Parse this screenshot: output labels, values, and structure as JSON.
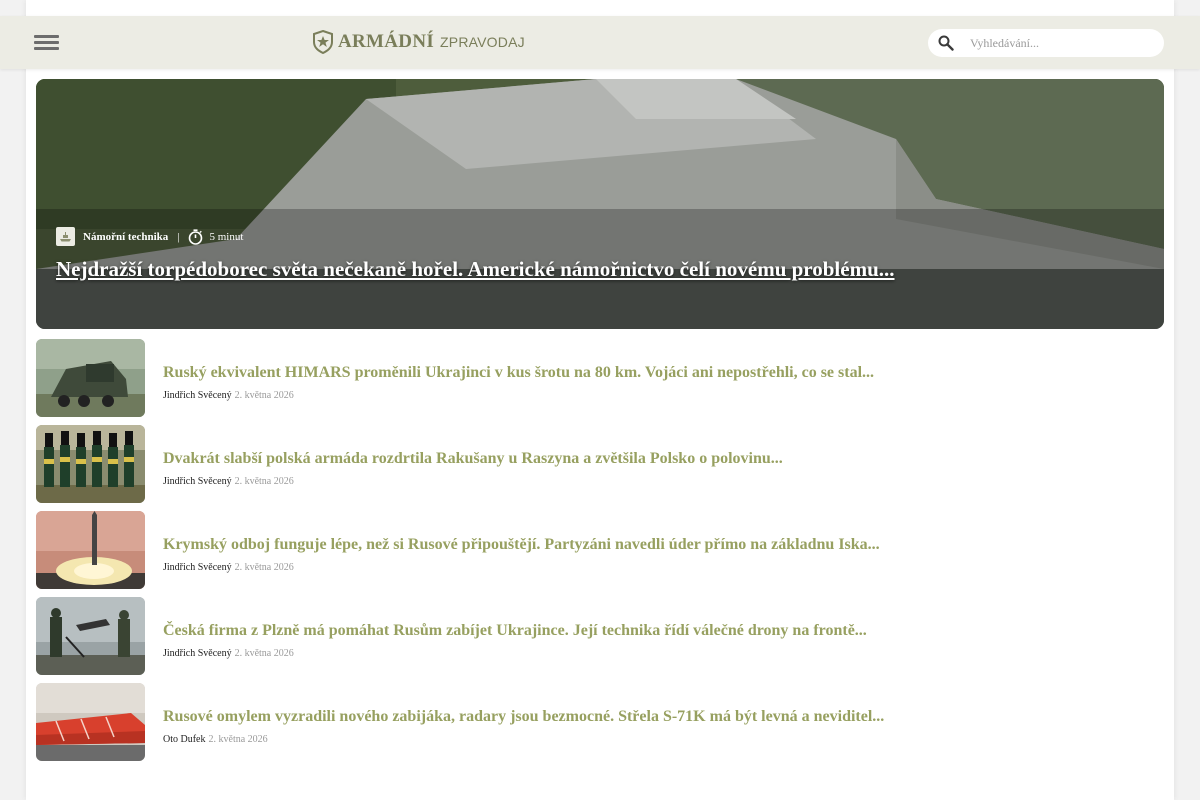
{
  "header": {
    "logo_primary": "ARMÁDNÍ",
    "logo_secondary": "ZPRAVODAJ",
    "search_placeholder": "Vyhledávání..."
  },
  "hero": {
    "category": "Námořní technika",
    "separator": "|",
    "read_time": "5 minut",
    "title": "Nejdražší torpédoborec světa nečekaně hořel. Americké námořnictvo čelí novému problému..."
  },
  "articles": [
    {
      "title": "Ruský ekvivalent HIMARS proměnili Ukrajinci v kus šrotu na 80 km. Vojáci ani nepostřehli, co se stal...",
      "author": "Jindřich Svěcený",
      "date": "2. května 2026"
    },
    {
      "title": "Dvakrát slabší polská armáda rozdrtila Rakušany u Raszyna a zvětšila Polsko o polovinu...",
      "author": "Jindřich Svěcený",
      "date": "2. května 2026"
    },
    {
      "title": "Krymský odboj funguje lépe, než si Rusové připouštějí. Partyzáni navedli úder přímo na základnu Iska...",
      "author": "Jindřich Svěcený",
      "date": "2. května 2026"
    },
    {
      "title": "Česká firma z Plzně má pomáhat Rusům zabíjet Ukrajince. Její technika řídí válečné drony na frontě...",
      "author": "Jindřich Svěcený",
      "date": "2. května 2026"
    },
    {
      "title": "Rusové omylem vyzradili nového zabijáka, radary jsou bezmocné. Střela S-71K má být levná a neviditel...",
      "author": "Oto Dufek",
      "date": "2. května 2026"
    }
  ],
  "colors": {
    "header_bg": "#ecece4",
    "brand": "#7a7e5a",
    "article_title": "#97a060"
  }
}
